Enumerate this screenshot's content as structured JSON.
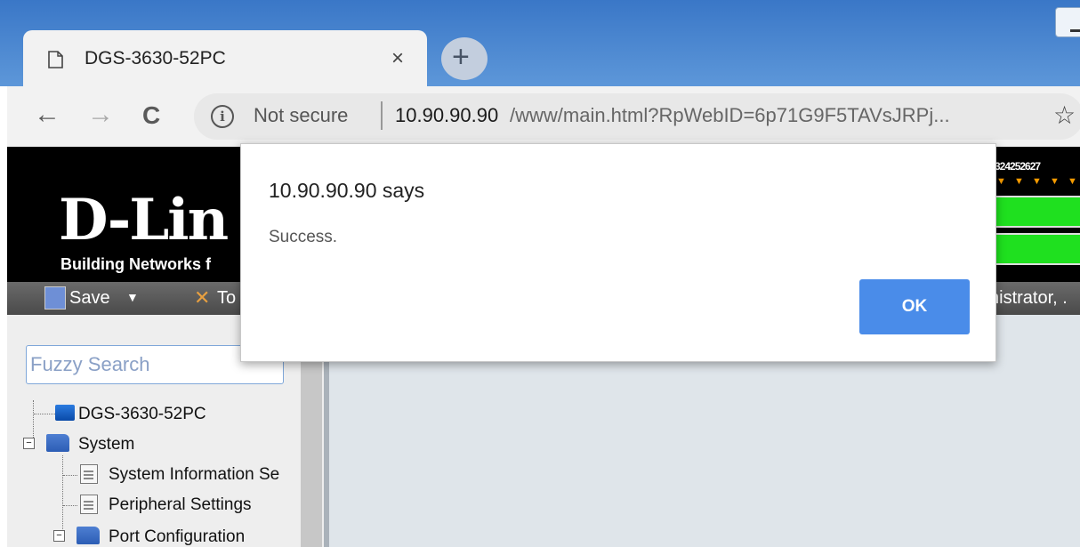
{
  "browser": {
    "tab": {
      "title": "DGS-3630-52PC",
      "close": "×"
    },
    "new_tab": "+",
    "nav": {
      "back": "←",
      "forward": "→",
      "reload": "C"
    },
    "address": {
      "info": "i",
      "security_label": "Not secure",
      "host": "10.90.90.90",
      "path": "/www/main.html?RpWebID=6p71G9F5TAVsJRPj...",
      "bookmark_icon": "star-icon"
    }
  },
  "banner": {
    "logo": "D-Lin",
    "tagline": "Building Networks f",
    "port_numbers": "3242526",
    "port_tail": "27"
  },
  "menubar": {
    "save_label": "Save",
    "tools_label": "To",
    "user_label": "nistrator, ."
  },
  "sidebar": {
    "search_placeholder": "Fuzzy Search",
    "tree": {
      "root": "DGS-3630-52PC",
      "system": "System",
      "system_info": "System Information Se",
      "peripheral": "Peripheral Settings",
      "port_config": "Port Configuration"
    }
  },
  "dialog": {
    "title": "10.90.90.90 says",
    "message": "Success.",
    "ok_label": "OK",
    "ok_color": "#4a8ce9"
  }
}
